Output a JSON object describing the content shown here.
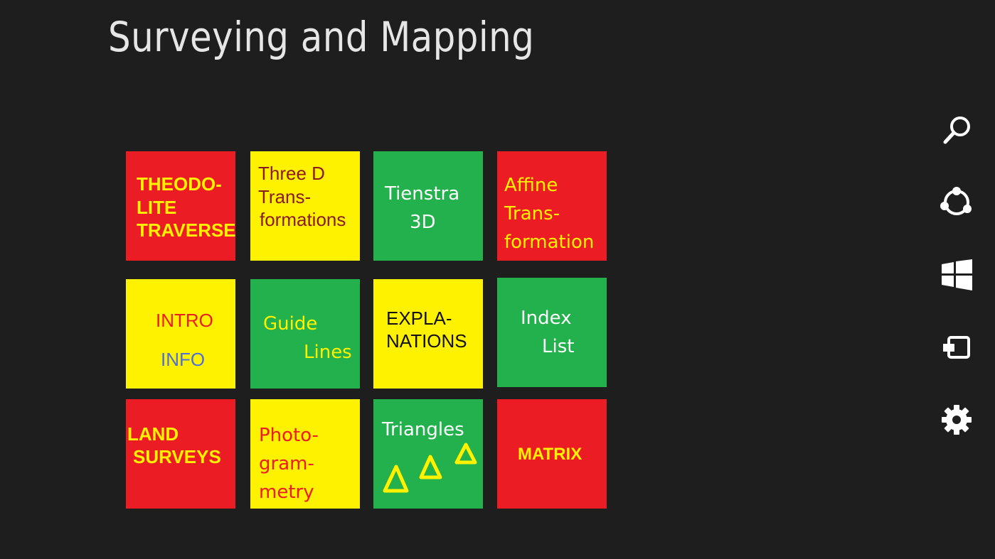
{
  "app": {
    "title": "Surveying and Mapping"
  },
  "tiles": {
    "theodolite": {
      "line1": "THEODO-",
      "line2": "LITE",
      "line3": "TRAVERSE"
    },
    "three_d": {
      "line1": "Three D",
      "line2": "Trans-",
      "line3": "formations"
    },
    "tienstra": {
      "line1": "Tienstra",
      "line2": "3D"
    },
    "affine": {
      "line1": "Affine",
      "line2": "Trans-",
      "line3": "formation"
    },
    "intro": {
      "line1": "INTRO",
      "line2": "INFO"
    },
    "guide": {
      "line1": "Guide",
      "line2": "Lines"
    },
    "explanations": {
      "line1": "EXPLA-",
      "line2": "NATIONS"
    },
    "index": {
      "line1": "Index",
      "line2": "List"
    },
    "land": {
      "line1": "LAND",
      "line2": "SURVEYS"
    },
    "photo": {
      "line1": "Photo-",
      "line2": "gram-",
      "line3": "metry"
    },
    "triangles": {
      "line1": "Triangles"
    },
    "matrix": {
      "line1": "MATRIX"
    }
  },
  "charms": [
    "search-icon",
    "share-icon",
    "start-icon",
    "devices-icon",
    "settings-icon"
  ],
  "colors": {
    "background": "#1e1e1e",
    "red": "#ec1c24",
    "yellow": "#fff200",
    "green": "#22b14c"
  }
}
